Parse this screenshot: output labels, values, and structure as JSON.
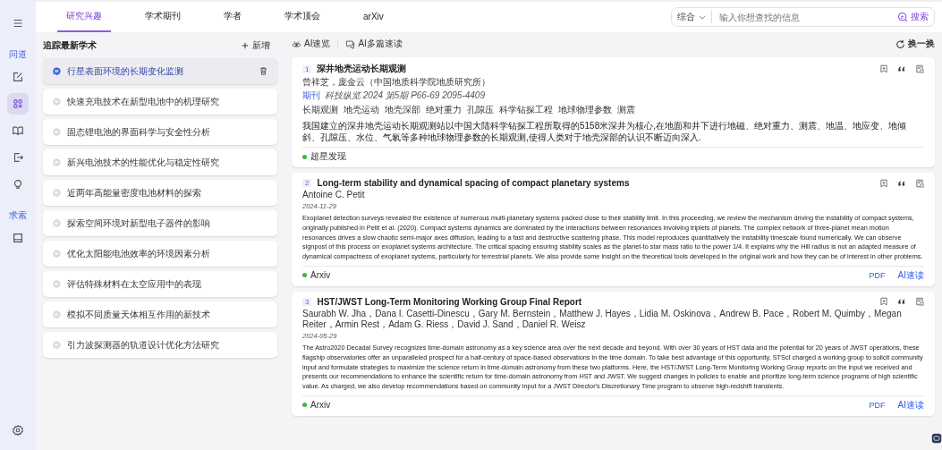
{
  "rail": {
    "items": [
      {
        "kind": "menu",
        "selected": false
      },
      {
        "kind": "label",
        "text": "问道"
      },
      {
        "kind": "edit",
        "selected": false
      },
      {
        "kind": "apps",
        "selected": true
      },
      {
        "kind": "book",
        "selected": false
      },
      {
        "kind": "export",
        "selected": false
      },
      {
        "kind": "bulb",
        "selected": false
      },
      {
        "kind": "label",
        "text": "求索"
      },
      {
        "kind": "doc",
        "selected": false
      }
    ],
    "bottom": [
      {
        "kind": "settings",
        "selected": false
      }
    ]
  },
  "tabs": [
    {
      "label": "研究兴趣",
      "selected": true
    },
    {
      "label": "学术期刊",
      "selected": false
    },
    {
      "label": "学者",
      "selected": false
    },
    {
      "label": "学术顶会",
      "selected": false
    },
    {
      "label": "arXiv",
      "selected": false
    }
  ],
  "search": {
    "scope": "综合",
    "placeholder": "输入你想查找的信息",
    "button": "搜索"
  },
  "topics": {
    "title": "追踪最新学术",
    "add": "新增",
    "items": [
      {
        "label": "行星表面环境的长期变化监测",
        "selected": true
      },
      {
        "label": "快速充电技术在新型电池中的机理研究",
        "selected": false
      },
      {
        "label": "固态锂电池的界面科学与安全性分析",
        "selected": false
      },
      {
        "label": "新兴电池技术的性能优化与稳定性研究",
        "selected": false
      },
      {
        "label": "近两年高能量密度电池材料的探索",
        "selected": false
      },
      {
        "label": "探索空间环境对新型电子器件的影响",
        "selected": false
      },
      {
        "label": "优化太阳能电池效率的环境因素分析",
        "selected": false
      },
      {
        "label": "评估特殊材料在太空应用中的表现",
        "selected": false
      },
      {
        "label": "模拟不同质量天体相互作用的新技术",
        "selected": false
      },
      {
        "label": "引力波探测器的轨道设计优化方法研究",
        "selected": false
      }
    ]
  },
  "toolbar": {
    "quick": "AI速览",
    "multi": "AI多篇速读",
    "refresh": "换一换"
  },
  "papers": [
    {
      "number": "1",
      "title": "深井地壳运动长期观测",
      "authors": "曾祥芝，庞金云（中国地质科学院地质研究所）",
      "journal_label": "期刊",
      "journal": "科技纵览 2024 第5期 P66-69 2095-4409",
      "keywords": [
        "长期观测",
        "地壳运动",
        "地壳深部",
        "绝对重力",
        "孔隙压",
        "科学钻探工程",
        "地球物理参数",
        "测震"
      ],
      "abstract": "我国建立的深井地壳运动长期观测站以中国大陆科学钻探工程所取得的5158米深井为核心,在地面和井下进行地磁、绝对重力、测震、地温、地应变、地倾斜、孔隙压、水位、气氡等多种地球物理参数的长期观测,使得人类对于地壳深部的认识不断迈向深入.",
      "source": "超星发现"
    },
    {
      "number": "2",
      "title": "Long-term stability and dynamical spacing of compact planetary systems",
      "authors": "Antoine C. Petit",
      "date": "2024-11-29",
      "abstract": "Exoplanet detection surveys revealed the existence of numerous multi-planetary systems packed close to their stability limit. In this proceeding, we review the mechanism driving the instability of compact systems, originally published in Petit et al. (2020). Compact systems dynamics are dominated by the interactions between resonances involving triplets of planets. The complex network of three-planet mean motion resonances drives a slow chaotic semi-major axes diffusion, leading to a fast and destructive scattering phase. This model reproduces quantitatively the instability timescale found numerically. We can observe signpost of this process on exoplanet systems architecture. The critical spacing ensuring stability scales as the planet-to star mass ratio to the power 1/4. It explains why the Hill radius is not an adapted measure of dynamical compactness of exoplanet systems, particularly for terrestrial planets. We also provide some insight on the theoretical tools developed in the original work and how they can be of interest in other problems.",
      "source": "Arxiv",
      "links": [
        "PDF",
        "AI速读"
      ]
    },
    {
      "number": "3",
      "title": "HST/JWST Long-Term Monitoring Working Group Final Report",
      "authors": "Saurabh W. Jha，Dana I. Casetti-Dinescu，Gary M. Bernstein，Matthew J. Hayes，Lidia M. Oskinova，Andrew B. Pace，Robert M. Quimby，Megan Reiter，Armin Rest，Adam G. Riess，David J. Sand，Daniel R. Weisz",
      "date": "2024-05-29",
      "abstract": "The Astro2020 Decadal Survey recognizes time-domain astronomy as a key science area over the next decade and beyond. With over 30 years of HST data and the potential for 20 years of JWST operations, these flagship observatories offer an unparalleled prospect for a half-century of space-based observations in the time domain. To take best advantage of this opportunity, STScI charged a working group to solicit community input and formulate strategies to maximize the science return in time-domain astronomy from these two platforms. Here, the HST/JWST Long-Term Monitoring Working Group reports on the input we received and presents our recommendations to enhance the scientific return for time-domain astronomy from HST and JWST. We suggest changes in policies to enable and prioritize long-term science programs of high scientific value. As charged, we also develop recommendations based on community input for a JWST Director's Discretionary Time program to observe high-redshift transients.",
      "source": "Arxiv",
      "links": [
        "PDF",
        "AI速读"
      ]
    }
  ]
}
